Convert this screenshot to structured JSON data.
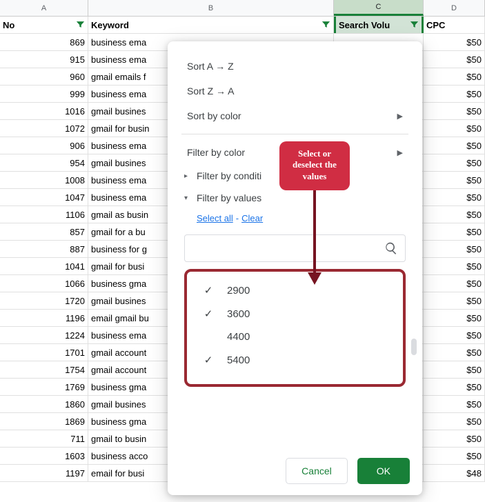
{
  "colheads": {
    "a": "A",
    "b": "B",
    "c": "C",
    "d": "D"
  },
  "headers": {
    "no": "No",
    "keyword": "Keyword",
    "search_volume": "Search Volu",
    "cpc": "CPC"
  },
  "rows": [
    {
      "no": 869,
      "kw": "business ema",
      "cpc": "$50"
    },
    {
      "no": 915,
      "kw": "business ema",
      "cpc": "$50"
    },
    {
      "no": 960,
      "kw": "gmail emails f",
      "cpc": "$50"
    },
    {
      "no": 999,
      "kw": "business ema",
      "cpc": "$50"
    },
    {
      "no": 1016,
      "kw": "gmail busines",
      "cpc": "$50"
    },
    {
      "no": 1072,
      "kw": "gmail for busin",
      "cpc": "$50"
    },
    {
      "no": 906,
      "kw": "business ema",
      "cpc": "$50"
    },
    {
      "no": 954,
      "kw": "gmail busines",
      "cpc": "$50"
    },
    {
      "no": 1008,
      "kw": "business ema",
      "cpc": "$50"
    },
    {
      "no": 1047,
      "kw": "business ema",
      "cpc": "$50"
    },
    {
      "no": 1106,
      "kw": "gmail as busin",
      "cpc": "$50"
    },
    {
      "no": 857,
      "kw": "gmail for a bu",
      "cpc": "$50"
    },
    {
      "no": 887,
      "kw": "business for g",
      "cpc": "$50"
    },
    {
      "no": 1041,
      "kw": "gmail for busi",
      "cpc": "$50"
    },
    {
      "no": 1066,
      "kw": "business gma",
      "cpc": "$50"
    },
    {
      "no": 1720,
      "kw": "gmail busines",
      "cpc": "$50"
    },
    {
      "no": 1196,
      "kw": "email gmail bu",
      "cpc": "$50"
    },
    {
      "no": 1224,
      "kw": "business ema",
      "cpc": "$50"
    },
    {
      "no": 1701,
      "kw": "gmail account",
      "cpc": "$50"
    },
    {
      "no": 1754,
      "kw": "gmail account",
      "cpc": "$50"
    },
    {
      "no": 1769,
      "kw": "business gma",
      "cpc": "$50"
    },
    {
      "no": 1860,
      "kw": "gmail busines",
      "cpc": "$50"
    },
    {
      "no": 1869,
      "kw": "business gma",
      "cpc": "$50"
    },
    {
      "no": 711,
      "kw": "gmail to busin",
      "cpc": "$50"
    },
    {
      "no": 1603,
      "kw": "business acco",
      "cpc": "$50"
    },
    {
      "no": 1197,
      "kw": "email for busi",
      "cpc": "$48"
    }
  ],
  "menu": {
    "sort_az": "Sort A → Z",
    "sort_za": "Sort Z → A",
    "sort_color": "Sort by color",
    "filter_color": "Filter by color",
    "filter_condition": "Filter by conditi",
    "filter_values": "Filter by values"
  },
  "links": {
    "select_all": "Select all",
    "clear": "Clear"
  },
  "search_placeholder": "",
  "values": [
    {
      "label": "2900",
      "checked": true
    },
    {
      "label": "3600",
      "checked": true
    },
    {
      "label": "4400",
      "checked": false
    },
    {
      "label": "5400",
      "checked": true
    }
  ],
  "buttons": {
    "cancel": "Cancel",
    "ok": "OK"
  },
  "annotation": "Select or deselect the values"
}
